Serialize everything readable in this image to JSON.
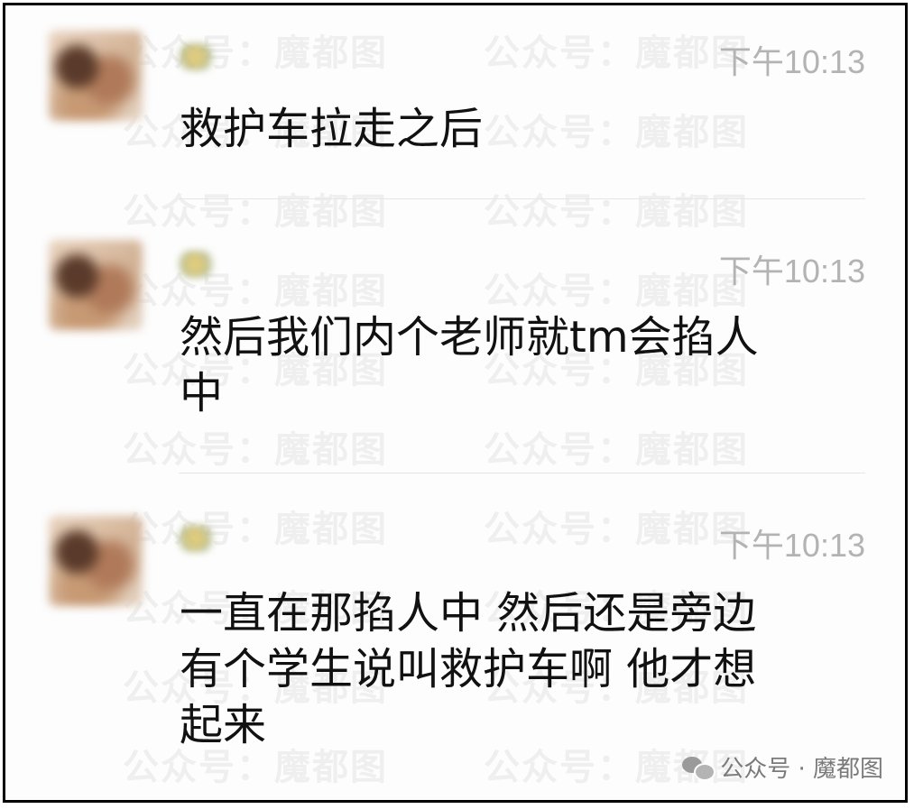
{
  "watermark": "公众号：魔都图",
  "messages": [
    {
      "time": "下午10:13",
      "text": "救护车拉走之后"
    },
    {
      "time": "下午10:13",
      "text": "然后我们内个老师就tm会掐人\n中"
    },
    {
      "time": "下午10:13",
      "text": "一直在那掐人中  然后还是旁边\n有个学生说叫救护车啊  他才想\n起来"
    }
  ],
  "footer": {
    "label": "公众号 · 魔都图",
    "icon": "wechat-icon"
  }
}
